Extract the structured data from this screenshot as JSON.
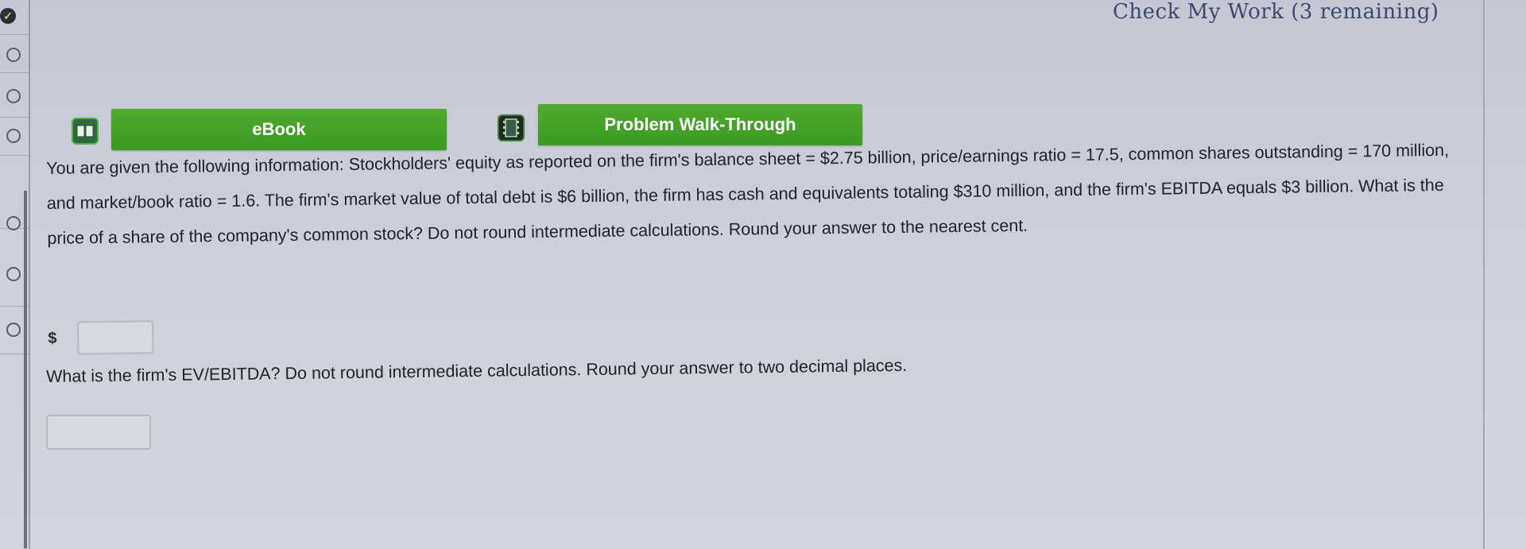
{
  "header": {
    "check_my_work": "Check My Work (3 remaining)"
  },
  "rail": {
    "items": [
      {
        "status": "complete",
        "icon": "check-icon"
      },
      {
        "status": "incomplete"
      },
      {
        "status": "incomplete"
      },
      {
        "status": "incomplete"
      },
      {
        "status": "incomplete"
      },
      {
        "status": "incomplete"
      },
      {
        "status": "incomplete"
      }
    ]
  },
  "buttons": {
    "ebook_label": "eBook",
    "ebook_icon": "book-icon",
    "walkthrough_label": "Problem Walk-Through",
    "walkthrough_icon": "film-icon",
    "accent_color": "#3f9e26"
  },
  "question": {
    "text": "You are given the following information: Stockholders' equity as reported on the firm's balance sheet = $2.75 billion, price/earnings ratio = 17.5, common shares outstanding = 170 million, and market/book ratio = 1.6. The firm's market value of total debt is $6 billion, the firm has cash and equivalents totaling $310 million, and the firm's EBITDA equals $3 billion. What is the price of a share of the company's common stock? Do not round intermediate calculations. Round your answer to the nearest cent.",
    "currency_symbol": "$",
    "answer1_value": "",
    "part2_text": "What is the firm's EV/EBITDA? Do not round intermediate calculations. Round your answer to two decimal places.",
    "answer2_value": ""
  }
}
